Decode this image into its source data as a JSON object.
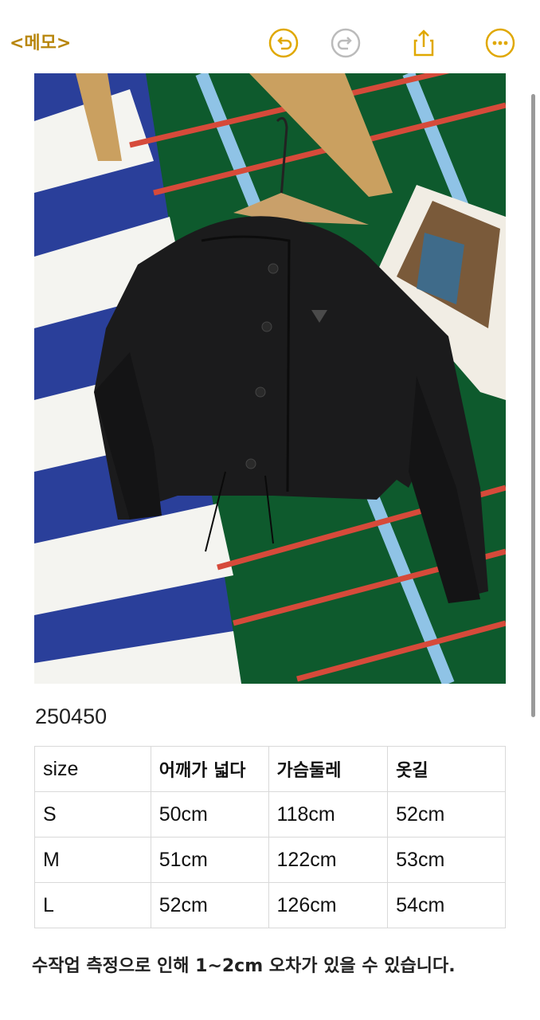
{
  "toolbar": {
    "back_label": "<메모>",
    "icons": [
      "undo-icon",
      "redo-icon",
      "share-icon",
      "more-icon"
    ],
    "accent": "#e0a800"
  },
  "photo": {
    "description_icon": "product-photo"
  },
  "product": {
    "code": "250450"
  },
  "size_table": {
    "headers": [
      "size",
      "어깨가 넓다",
      "가슴둘레",
      "옷길"
    ],
    "rows": [
      [
        "S",
        "50cm",
        "118cm",
        "52cm"
      ],
      [
        "M",
        "51cm",
        "122cm",
        "53cm"
      ],
      [
        "L",
        "52cm",
        "126cm",
        "54cm"
      ]
    ]
  },
  "note": "수작업 측정으로 인해 1~2cm 오차가 있을 수 있습니다."
}
